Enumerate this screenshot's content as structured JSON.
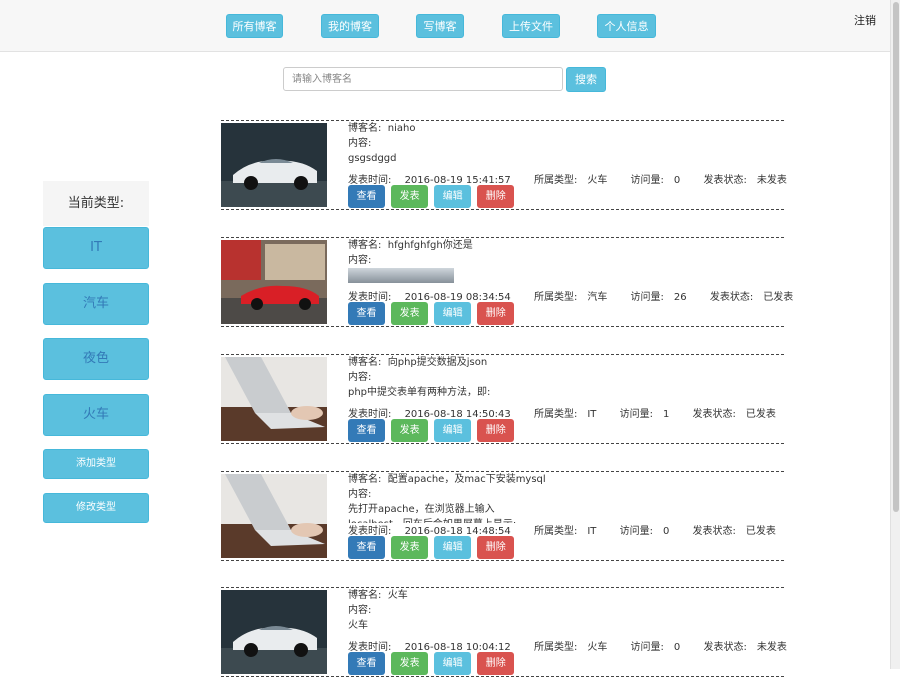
{
  "nav": {
    "all_blogs": "所有博客",
    "my_blogs": "我的博客",
    "write_blog": "写博客",
    "upload_file": "上传文件",
    "profile": "个人信息",
    "logout": "注销"
  },
  "search": {
    "placeholder": "请输入博客名",
    "button": "搜索"
  },
  "sidebar": {
    "title": "当前类型:",
    "types": [
      "IT",
      "汽车",
      "夜色",
      "火车"
    ],
    "add_type": "添加类型",
    "edit_type": "修改类型"
  },
  "labels": {
    "name": "博客名:",
    "content": "内容:",
    "time": "发表时间:",
    "type": "所属类型:",
    "views": "访问量:",
    "status": "发表状态:"
  },
  "buttons": {
    "view": "查看",
    "publish": "发表",
    "edit": "编辑",
    "delete": "删除"
  },
  "posts": [
    {
      "name": "niaho",
      "content": [
        "gsgsdggd"
      ],
      "time": "2016-08-19 15:41:57",
      "type": "火车",
      "views": "0",
      "status": "未发表",
      "thumb": "white-car"
    },
    {
      "name": "hfghfghfgh你还是",
      "content": [],
      "time": "2016-08-19 08:34:54",
      "type": "汽车",
      "views": "26",
      "status": "已发表",
      "thumb": "red-car"
    },
    {
      "name": "向php提交数据及json",
      "content": [
        "php中提交表单有两种方法，即:"
      ],
      "time": "2016-08-18 14:50:43",
      "type": "IT",
      "views": "1",
      "status": "已发表",
      "thumb": "laptop"
    },
    {
      "name": "配置apache，及mac下安装mysql",
      "content": [
        "先打开apache，在浏览器上输入",
        "localhost，回车后会如果屏幕上显示:，"
      ],
      "time": "2016-08-18 14:48:54",
      "type": "IT",
      "views": "0",
      "status": "已发表",
      "thumb": "laptop"
    },
    {
      "name": "火车",
      "content": [
        "火车"
      ],
      "time": "2016-08-18 10:04:12",
      "type": "火车",
      "views": "0",
      "status": "未发表",
      "thumb": "white-car"
    }
  ]
}
